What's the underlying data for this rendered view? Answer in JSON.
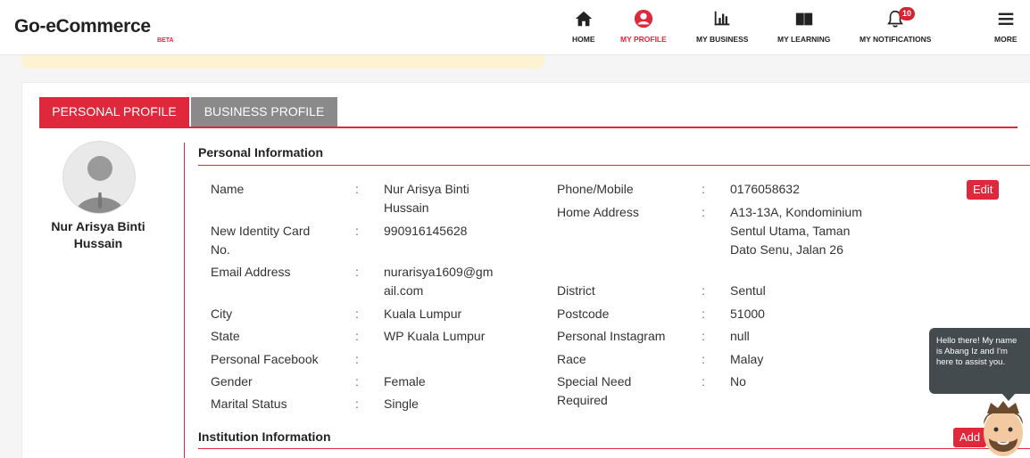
{
  "brand": {
    "name": "Go-eCommerce",
    "tag": "BETA"
  },
  "nav": [
    {
      "label": "HOME",
      "icon": "home-icon"
    },
    {
      "label": "MY PROFILE",
      "icon": "user-circle-icon",
      "active": true
    },
    {
      "label": "MY BUSINESS",
      "icon": "bar-chart-icon"
    },
    {
      "label": "MY LEARNING",
      "icon": "book-icon"
    },
    {
      "label": "MY NOTIFICATIONS",
      "icon": "bell-icon",
      "badge": "10"
    },
    {
      "label": "MORE",
      "icon": "hamburger-icon"
    }
  ],
  "tabs": {
    "personal": "PERSONAL PROFILE",
    "business": "BUSINESS PROFILE"
  },
  "profile": {
    "name": "Nur Arisya Binti Hussain"
  },
  "personal": {
    "title": "Personal Information",
    "edit_label": "Edit",
    "left": [
      {
        "label": "Name",
        "value": "Nur Arisya Binti Hussain"
      },
      {
        "label": "New Identity Card No.",
        "value": "990916145628"
      },
      {
        "label": "Email Address",
        "value": "nurarisya1609@gmail.com"
      },
      {
        "label": "City",
        "value": "Kuala Lumpur"
      },
      {
        "label": "State",
        "value": "WP Kuala Lumpur"
      },
      {
        "label": "Personal Facebook",
        "value": ""
      },
      {
        "label": "Gender",
        "value": "Female"
      },
      {
        "label": "Marital Status",
        "value": "Single"
      }
    ],
    "right": [
      {
        "label": "Phone/Mobile",
        "value": "0176058632"
      },
      {
        "label": "Home Address",
        "value": "A13-13A, Kondominium Sentul Utama, Taman Dato Senu, Jalan 26"
      },
      {
        "label": "District",
        "value": "Sentul"
      },
      {
        "label": "Postcode",
        "value": "51000"
      },
      {
        "label": "Personal Instagram",
        "value": "null"
      },
      {
        "label": "Race",
        "value": "Malay"
      },
      {
        "label": "Special Need Required",
        "value": "No"
      }
    ]
  },
  "institution": {
    "title": "Institution Information",
    "add_label": "Add"
  },
  "chat": {
    "message": "Hello there! My name is Abang Iz and I'm here to assist you."
  },
  "colors": {
    "accent": "#e0283c",
    "tab_inactive": "#8a8a8a",
    "chat_bg": "#444b4f",
    "notice": "#fdf3d3"
  },
  "separator": ":"
}
